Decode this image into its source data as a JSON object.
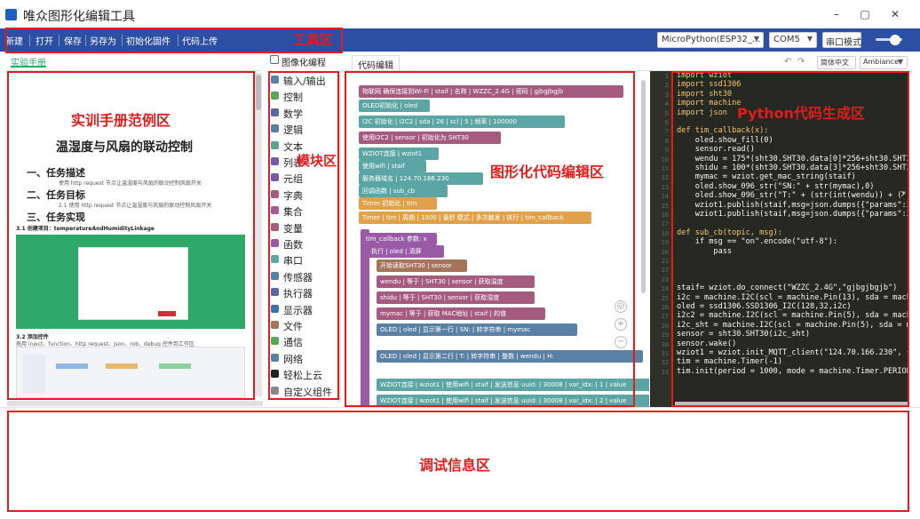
{
  "window": {
    "title": "唯众图形化编辑工具",
    "controls": [
      "–",
      "▢",
      "✕"
    ]
  },
  "toolbar": {
    "buttons": [
      "新建",
      "打开",
      "保存",
      "另存为",
      "初始化固件",
      "代码上传"
    ],
    "firmware_select": "MicroPython(ESP32_...",
    "port_select": "COM5",
    "serial_mode_button": "串口模式"
  },
  "left_panel": {
    "tab": "实验手册",
    "doc": {
      "title": "温湿度与风扇的联动控制",
      "section1": "一、任务描述",
      "section1_text": "使用 http request 节点让温湿度与风扇的联动控制风扇开关",
      "section2": "二、任务目标",
      "section2_text": "2.1 使用 http request 节点让温湿度与风扇的联动控制风扇开关",
      "section3": "三、任务实现",
      "step1": "3.1 创建项目：temperatureAndHumidityLinkage",
      "step2": "3.2 添加控件",
      "step2_text": "拖用 inject、function、http request、json、rob、debug 控件到工作区"
    }
  },
  "block_tab": "图像化编程",
  "categories": [
    "输入/输出",
    "控制",
    "数学",
    "逻辑",
    "文本",
    "列表",
    "元组",
    "字典",
    "集合",
    "变量",
    "函数",
    "串口",
    "传感器",
    "执行器",
    "显示器",
    "文件",
    "通信",
    "网络",
    "轻松上云",
    "自定义组件"
  ],
  "category_colors": [
    "#5b80a5",
    "#5ba55b",
    "#5b67a5",
    "#5b80a5",
    "#5ba58c",
    "#745ba5",
    "#745ba5",
    "#a55b80",
    "#a55b99",
    "#a55b80",
    "#995ba5",
    "#5ba5a5",
    "#5b80a5",
    "#5b67a5",
    "#3d6fb0",
    "#a5745b",
    "#5ba55b",
    "#5b80a5",
    "#222222",
    "#888888"
  ],
  "code_tab": "代码编辑",
  "code_controls": {
    "language": "简体中文",
    "theme": "Ambiance"
  },
  "blocks": [
    "物联网 确保连接到Wi-Fi | staif | 名称 | WZZC_2.4G | 密码 | gjbgjbgjb",
    "OLED初始化 | oled",
    "I2C 初始化 | i2C2 | sda | 26 | scl | 5 | 频率 | 100000",
    "使用I2C2 | sensor | 初始化为 SHT30",
    "WZIOT连接 | wziot1",
    "使用wifi | staif",
    "服务器域名 | 124.70.166.230",
    "回调函数 | sub_cb",
    "Timer 初始化 | tim",
    "Timer | tim | 周期 | 1000 | 毫秒 模式 | 多次触发 | 执行 | tim_callback",
    "tim_callback 参数: x",
    "执行 | oled | 清屏",
    "开始读取SHT30 | sensor",
    "wendu | 等于 | SHT30 | sensor | 获取温度",
    "shidu | 等于 | SHT30 | sensor | 获取湿度",
    "mymac | 等于 | 获取 MAC地址 | staif | 的值",
    "OLED | oled | 显示第一行 | SN: | 转字符串 | mymac",
    "OLED | oled | 显示第二行 | T: | 转字符串 | 整数 | wendu | H:",
    "WZIOT连接 | wziot1 | 使用wifi | staif | 发送信息 uuid: | 30008 | var_idx: | 1 | value",
    "WZIOT连接 | wziot1 | 使用wifi | staif | 发送信息 uuid: | 30008 | var_idx: | 2 | value"
  ],
  "code_lines": [
    "import wziot",
    "import ssd1306",
    "import sht30",
    "import machine",
    "import json",
    "",
    "def tim_callback(x):",
    "    oled.show_fill(0)",
    "    sensor.read()",
    "    wendu = 175*(sht30.SHT30.data[0]*256+sht30.SHT30",
    "    shidu = 100*(sht30.SHT30.data[3]*256+sht30.SHT30",
    "    mymac = wziot.get_mac_string(staif)",
    "    oled.show_096_str(\"SN:\" + str(mymac),0)",
    "    oled.show_096_str(\"T:\" + (str(int(wendu)) + (\"",
    "    wziot1.publish(staif,msg=json.dumps({\"params\":20",
    "    wziot1.publish(staif,msg=json.dumps({\"params\":20",
    "",
    "def sub_cb(topic, msg):",
    "    if msg == \"on\".encode(\"utf-8\"):",
    "        pass",
    "",
    "",
    "",
    "staif= wziot.do_connect(\"WZZC_2.4G\",\"gjbgjbgjb\")",
    "i2c = machine.I2C(scl = machine.Pin(13), sda = machi",
    "oled = ssd1306.SSD1306_I2C(128,32,i2c)",
    "i2c2 = machine.I2C(scl = machine.Pin(5), sda = machi",
    "i2c_sht = machine.I2C(scl = machine.Pin(5), sda = ma",
    "sensor = sht30.SHT30(i2c_sht)",
    "sensor.wake()",
    "wziot1 = wziot.init_MQTT_client(\"124.70.166.230\", st",
    "tim = machine.Timer(-1)",
    "tim.init(period = 1000, mode = machine.Timer.PERIODI"
  ],
  "annotations": {
    "toolbar_area": "工具区",
    "manual_area": "实训手册范例区",
    "module_area": "模块区",
    "graphic_editor_area": "图形化代码编辑区",
    "python_area": "Python代码生成区",
    "debug_area": "调试信息区"
  },
  "colors": {
    "toolbar": "#2c4fa3",
    "annotation": "#e21b1b",
    "code_bg": "#272822",
    "accent_green": "#2fa96a"
  }
}
